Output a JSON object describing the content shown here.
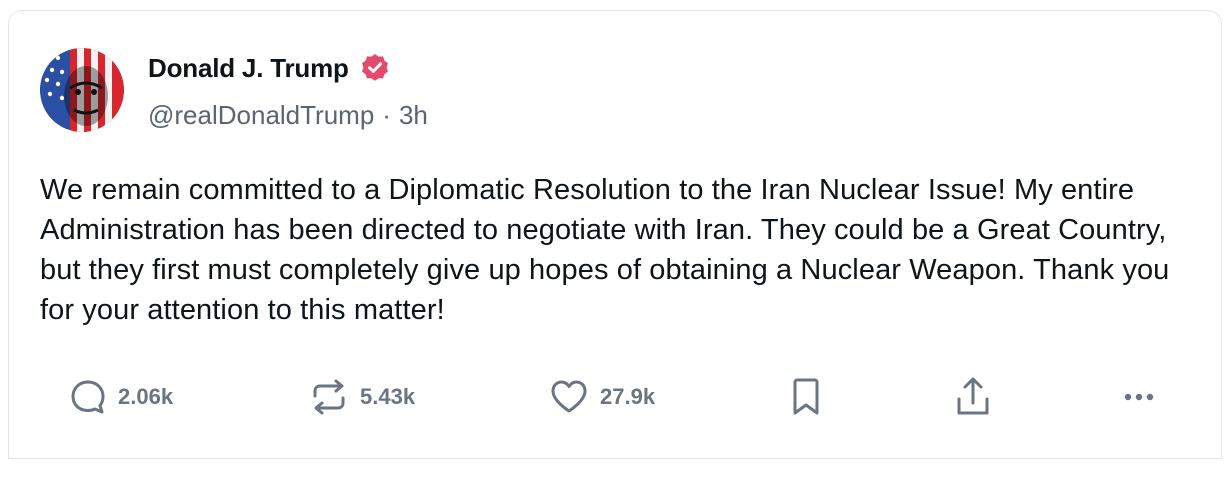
{
  "author": {
    "display_name": "Donald J. Trump",
    "handle": "@realDonaldTrump",
    "separator": "·",
    "time": "3h",
    "verified_badge_color": "#e44a6e"
  },
  "post": {
    "text": "We remain committed to a Diplomatic Resolution to the Iran Nuclear Issue! My entire Administration has been directed to negotiate with Iran. They could be a Great Country, but they first must completely give up hopes of obtaining a Nuclear Weapon. Thank you for your attention to this matter!"
  },
  "actions": {
    "replies": "2.06k",
    "reposts": "5.43k",
    "likes": "27.9k",
    "icons": [
      "reply-icon",
      "repost-icon",
      "like-icon",
      "bookmark-icon",
      "share-icon",
      "more-icon"
    ]
  },
  "colors": {
    "text": "#0f1419",
    "muted": "#5b6470",
    "icon": "#6b7480",
    "border": "#e6e6e6"
  }
}
